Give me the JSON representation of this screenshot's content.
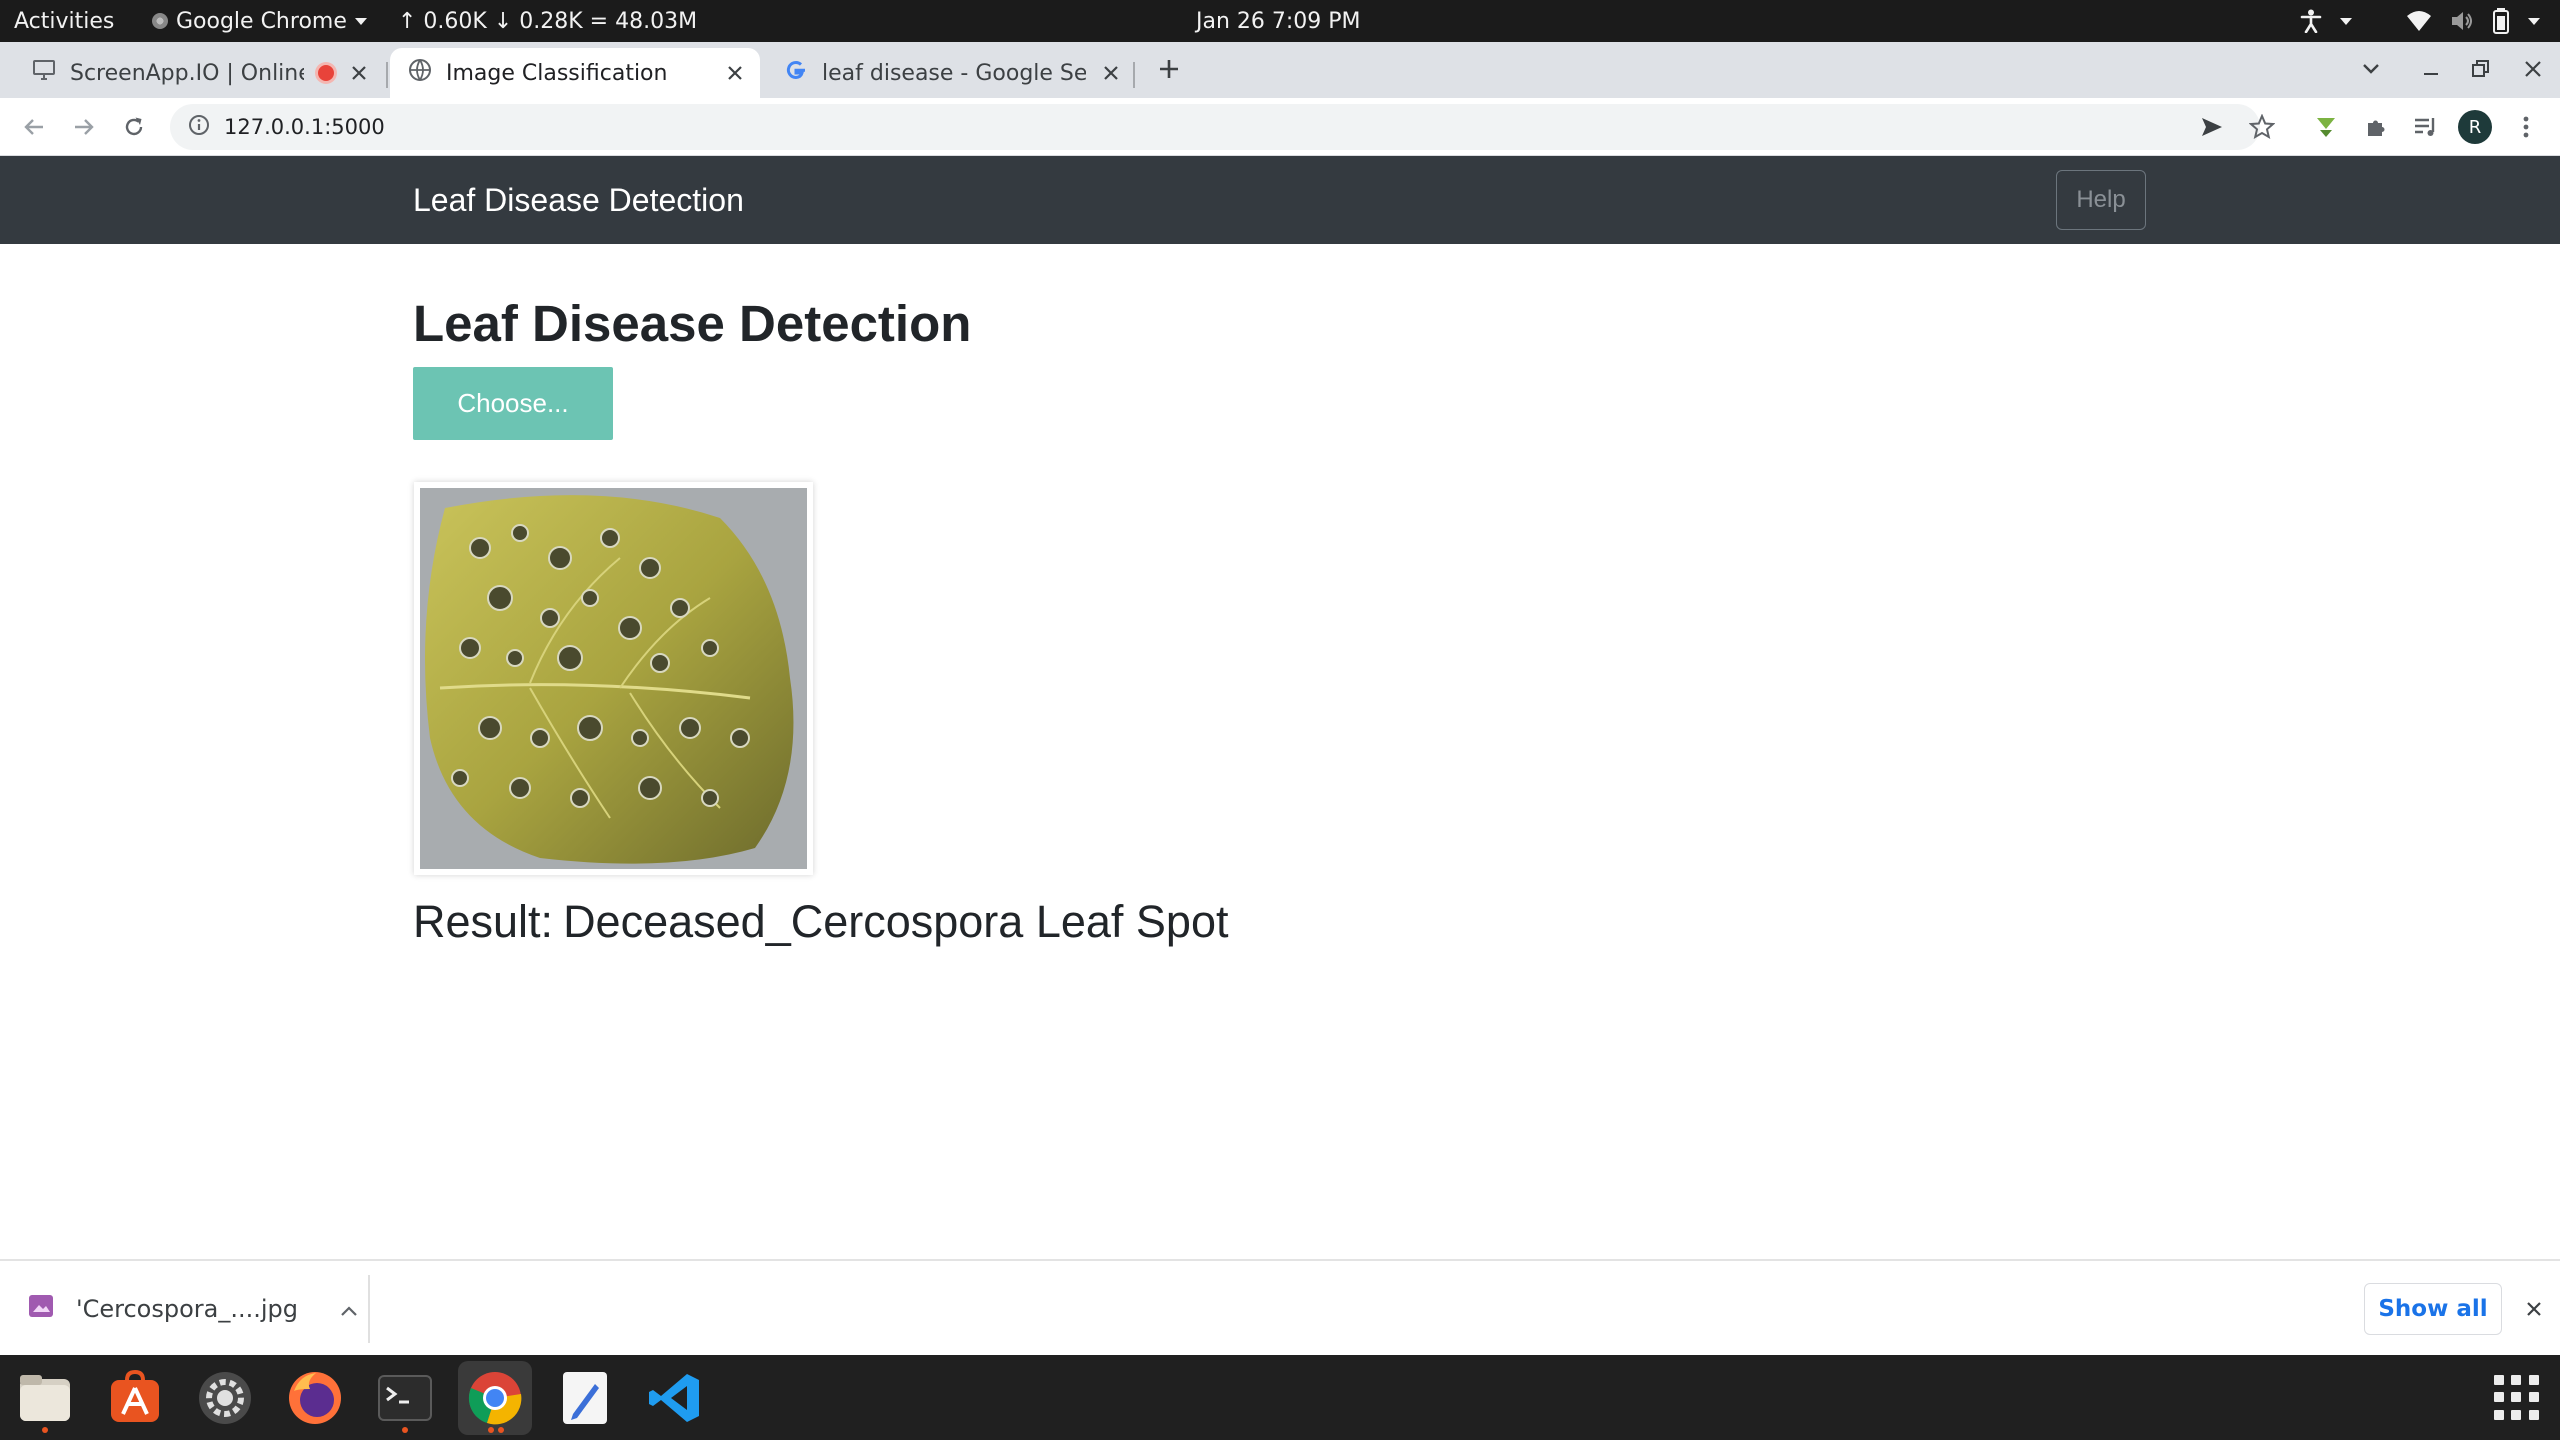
{
  "system_bar": {
    "activities": "Activities",
    "app_name": "Google Chrome",
    "net_stats": "↑ 0.60K ↓ 0.28K = 48.03M",
    "clock": "Jan 26  7:09 PM"
  },
  "browser": {
    "tabs": [
      {
        "title": "ScreenApp.IO | Online",
        "recording": true
      },
      {
        "title": "Image Classification",
        "active": true
      },
      {
        "title": "leaf disease - Google Search"
      }
    ],
    "url": "127.0.0.1:5000",
    "profile_initial": "R"
  },
  "page": {
    "brand": "Leaf Disease Detection",
    "help_label": "Help",
    "heading": "Leaf Disease Detection",
    "choose_label": "Choose...",
    "result_label": "Result:",
    "result_value": "Deceased_Cercospora Leaf Spot"
  },
  "downloads": {
    "file_name": "'Cercospora_....jpg",
    "show_all_label": "Show all"
  },
  "dock": {
    "apps": [
      "files",
      "software-center",
      "settings",
      "firefox",
      "terminal",
      "chrome",
      "text-editor",
      "vscode"
    ]
  },
  "colors": {
    "navbar": "#343a40",
    "choose_button": "#6cc4b3",
    "link_blue": "#1a73e8",
    "recording": "#e8433a"
  }
}
